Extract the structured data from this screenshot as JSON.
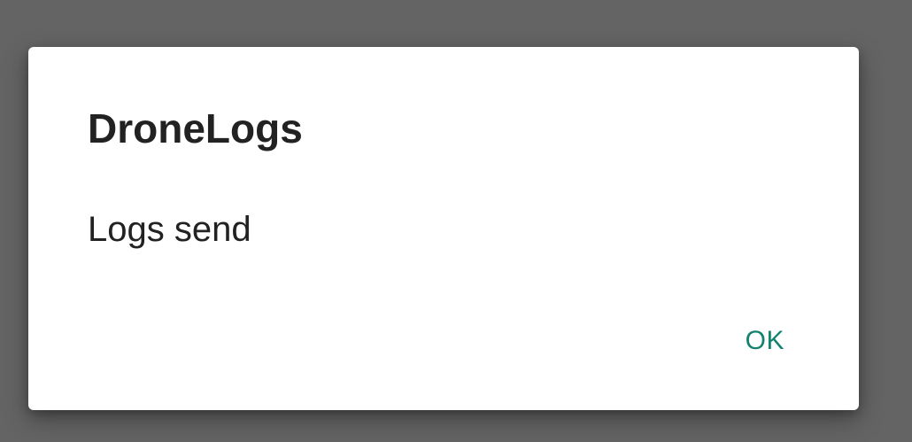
{
  "dialog": {
    "title": "DroneLogs",
    "message": "Logs send",
    "ok_label": "OK"
  },
  "colors": {
    "scrim": "#646464",
    "dialog_background": "#ffffff",
    "text": "#222222",
    "accent": "#13826e"
  }
}
